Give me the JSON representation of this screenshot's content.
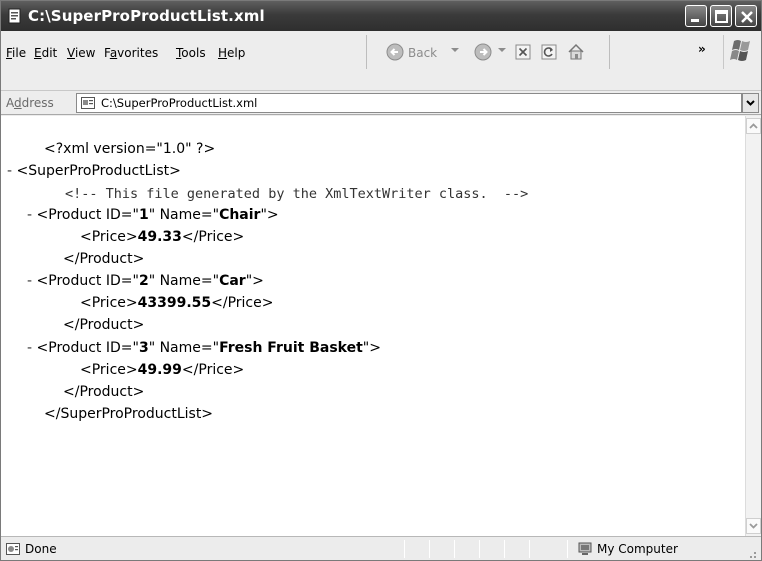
{
  "window": {
    "title": "C:\\SuperProProductList.xml"
  },
  "menu": {
    "file": {
      "mnemonic": "F",
      "rest": "ile"
    },
    "edit": {
      "mnemonic": "E",
      "rest": "dit"
    },
    "view": {
      "mnemonic": "V",
      "rest": "iew"
    },
    "favorites": {
      "pre": "F",
      "mnemonic": "a",
      "rest": "vorites"
    },
    "tools": {
      "mnemonic": "T",
      "rest": "ools"
    },
    "help": {
      "mnemonic": "H",
      "rest": "elp"
    }
  },
  "toolbar": {
    "back_label": "Back",
    "more_label": "»",
    "icons": [
      "back-icon",
      "forward-icon",
      "stop-icon",
      "refresh-icon",
      "home-icon"
    ]
  },
  "address": {
    "label_pre": "A",
    "label_mnemonic": "d",
    "label_rest": "dress",
    "url": "C:\\SuperProProductList.xml"
  },
  "xml": {
    "declaration": "<?xml version=\"1.0\" ?>",
    "collapse": "-",
    "root_open": "<SuperProProductList>",
    "comment": "<!-- This file generated by the XmlTextWriter class.  -->",
    "products": [
      {
        "id": "1",
        "name": "Chair",
        "price": "49.33"
      },
      {
        "id": "2",
        "name": "Car",
        "price": "43399.55"
      },
      {
        "id": "3",
        "name": "Fresh Fruit Basket",
        "price": "49.99"
      }
    ],
    "product_open_pre": "<Product ID=\"",
    "product_open_mid": "\" Name=\"",
    "product_open_end": "\">",
    "price_open": "<Price>",
    "price_close": "</Price>",
    "product_close": "</Product>",
    "root_close": "</SuperProProductList>"
  },
  "status": {
    "text": "Done",
    "zone": "My Computer"
  }
}
